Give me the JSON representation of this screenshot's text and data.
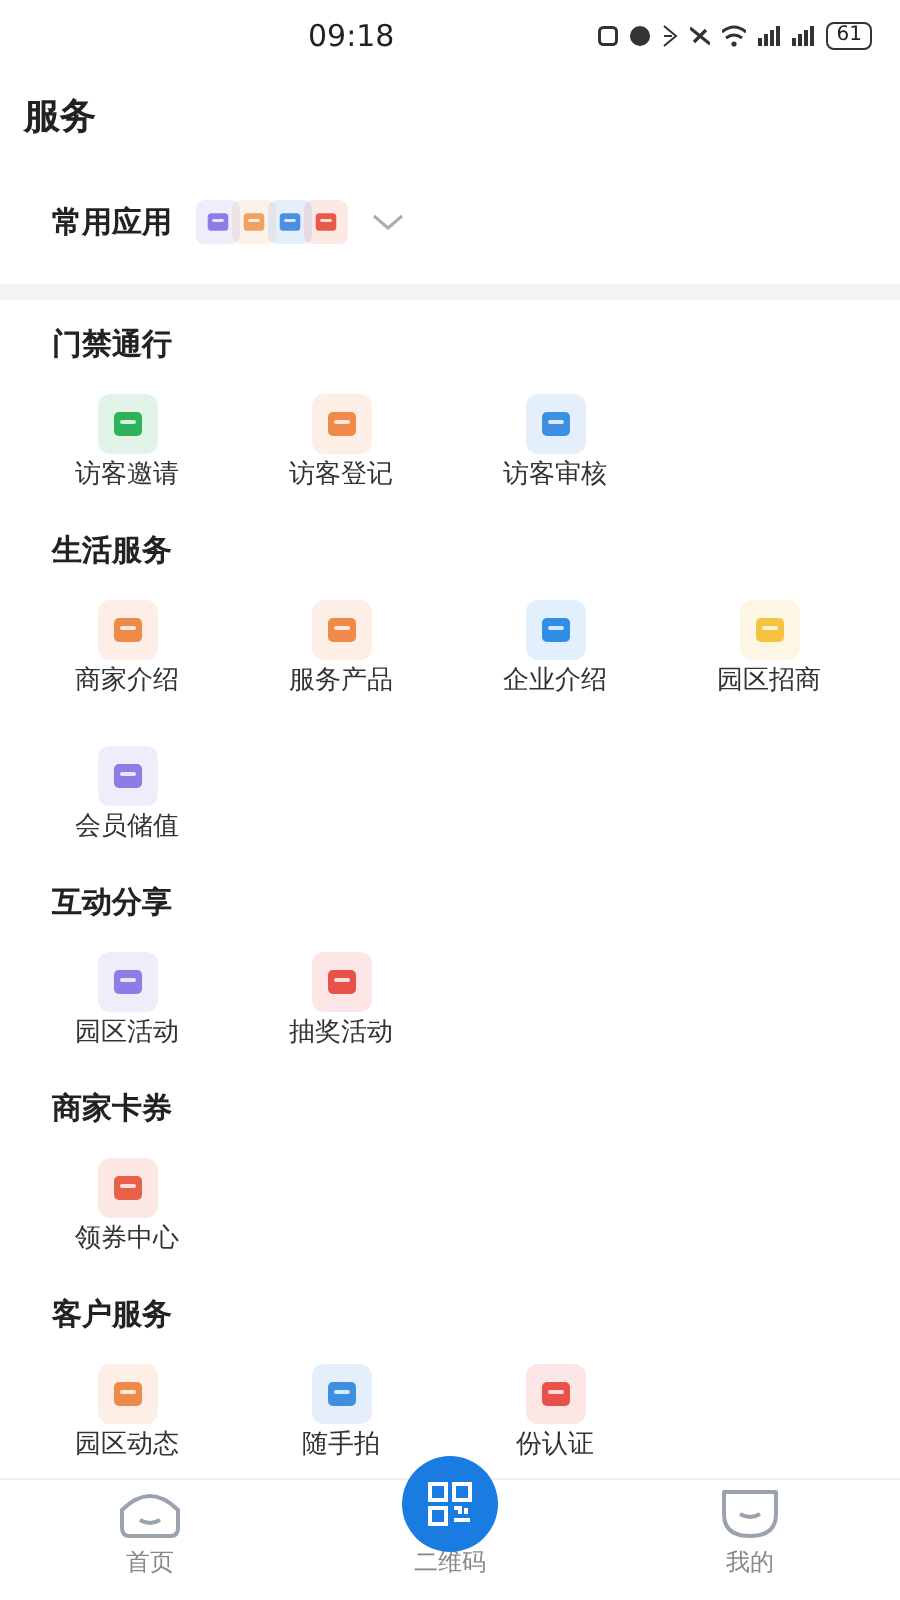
{
  "status_bar": {
    "time": "09:18",
    "battery": "61"
  },
  "title": "服务",
  "favorites": {
    "label": "常用应用",
    "icons": [
      {
        "color": "#8f7be8"
      },
      {
        "color": "#f0a060"
      },
      {
        "color": "#4a90e2"
      },
      {
        "color": "#e85a4a"
      }
    ],
    "expanded": false
  },
  "sections": [
    {
      "title": "门禁通行",
      "items": [
        {
          "label": "访客邀请",
          "color": "#2fb35a"
        },
        {
          "label": "访客登记",
          "color": "#f08a4b"
        },
        {
          "label": "访客审核",
          "color": "#3d8fe0"
        }
      ]
    },
    {
      "title": "生活服务",
      "items": [
        {
          "label": "商家介绍",
          "color": "#f08a4b"
        },
        {
          "label": "服务产品",
          "color": "#f08a4b"
        },
        {
          "label": "企业介绍",
          "color": "#2f8ee8"
        },
        {
          "label": "园区招商",
          "color": "#f5c242"
        },
        {
          "label": "会员储值",
          "color": "#8d7be8"
        }
      ]
    },
    {
      "title": "互动分享",
      "items": [
        {
          "label": "园区活动",
          "color": "#8d7be8"
        },
        {
          "label": "抽奖活动",
          "color": "#e8504a"
        }
      ]
    },
    {
      "title": "商家卡券",
      "items": [
        {
          "label": "领券中心",
          "color": "#e8604a"
        }
      ]
    },
    {
      "title": "客户服务",
      "items": [
        {
          "label": "园区动态",
          "color": "#f08a4b"
        },
        {
          "label": "随手拍",
          "color": "#3d8fe0"
        },
        {
          "label": "份认证",
          "color": "#e8504a"
        }
      ]
    }
  ],
  "tab_bar": [
    {
      "label": "首页",
      "kind": "home"
    },
    {
      "label": "二维码",
      "kind": "qr"
    },
    {
      "label": "我的",
      "kind": "profile"
    }
  ]
}
